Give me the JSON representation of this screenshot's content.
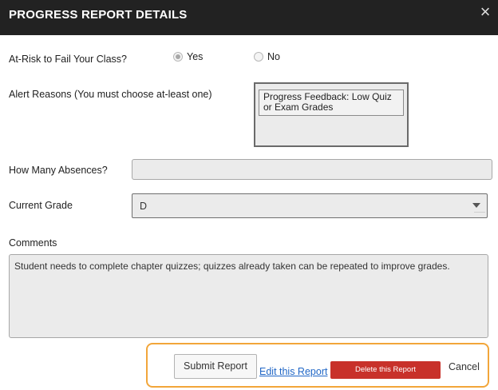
{
  "dialog": {
    "title": "PROGRESS REPORT DETAILS",
    "close_symbol": "×"
  },
  "at_risk": {
    "label": "At-Risk to Fail Your Class?",
    "options": [
      {
        "label": "Yes",
        "checked": true
      },
      {
        "label": "No",
        "checked": false
      }
    ]
  },
  "alert_reasons": {
    "label": "Alert Reasons (You must choose at-least one)",
    "options": [
      "Progress Feedback: Low Quiz or Exam Grades"
    ]
  },
  "absences": {
    "label": "How Many Absences?",
    "value": ""
  },
  "current_grade": {
    "label": "Current Grade",
    "value": "D"
  },
  "comments": {
    "label": "Comments",
    "value": "Student needs to complete chapter quizzes; quizzes already taken can be repeated to improve grades."
  },
  "actions": {
    "submit_label": "Submit Report",
    "edit_label": "Edit this Report",
    "delete_label": "Delete this Report",
    "cancel_label": "Cancel"
  },
  "colors": {
    "header_bg": "#222222",
    "delete_bg": "#c8312a",
    "link": "#1f66c6",
    "highlight_border": "#f2a63a"
  }
}
